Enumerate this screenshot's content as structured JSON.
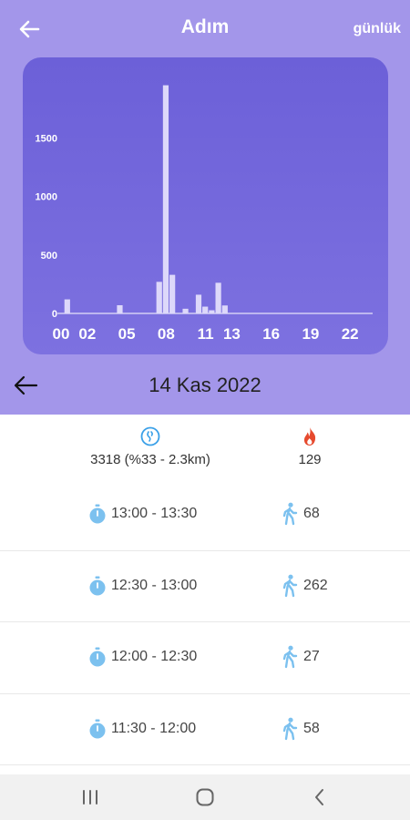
{
  "header": {
    "title": "Adım",
    "period": "günlük"
  },
  "chart_data": {
    "type": "bar",
    "x_ticks": [
      "00",
      "02",
      "05",
      "08",
      "11",
      "13",
      "16",
      "19",
      "22"
    ],
    "y_ticks": [
      "0",
      "500",
      "1000",
      "1500"
    ],
    "ylim": [
      0,
      1900
    ],
    "bars": [
      {
        "hour": 0,
        "half": 1,
        "value": 120
      },
      {
        "hour": 4,
        "half": 1,
        "value": 70
      },
      {
        "hour": 7,
        "half": 1,
        "value": 270
      },
      {
        "hour": 8,
        "half": 0,
        "value": 1950
      },
      {
        "hour": 8,
        "half": 1,
        "value": 330
      },
      {
        "hour": 9,
        "half": 1,
        "value": 40
      },
      {
        "hour": 10,
        "half": 1,
        "value": 160
      },
      {
        "hour": 11,
        "half": 0,
        "value": 58
      },
      {
        "hour": 11,
        "half": 1,
        "value": 27
      },
      {
        "hour": 12,
        "half": 0,
        "value": 262
      },
      {
        "hour": 12,
        "half": 1,
        "value": 68
      }
    ]
  },
  "date": {
    "label": "14 Kas 2022"
  },
  "summary": {
    "steps_text": "3318 (%33 - 2.3km)",
    "calories": "129",
    "steps_icon": "steps-badge-icon",
    "calories_icon": "flame-icon"
  },
  "records": [
    {
      "time": "13:00 - 13:30",
      "steps": "68"
    },
    {
      "time": "12:30 - 13:00",
      "steps": "262"
    },
    {
      "time": "12:00 - 12:30",
      "steps": "27"
    },
    {
      "time": "11:30 - 12:00",
      "steps": "58"
    }
  ],
  "colors": {
    "header_bg": "#a396ea",
    "chart_bg": "#6c60d8",
    "bar": "#ddd8fa",
    "icon_blue": "#7cc1ef",
    "flame": "#e64a2e"
  }
}
